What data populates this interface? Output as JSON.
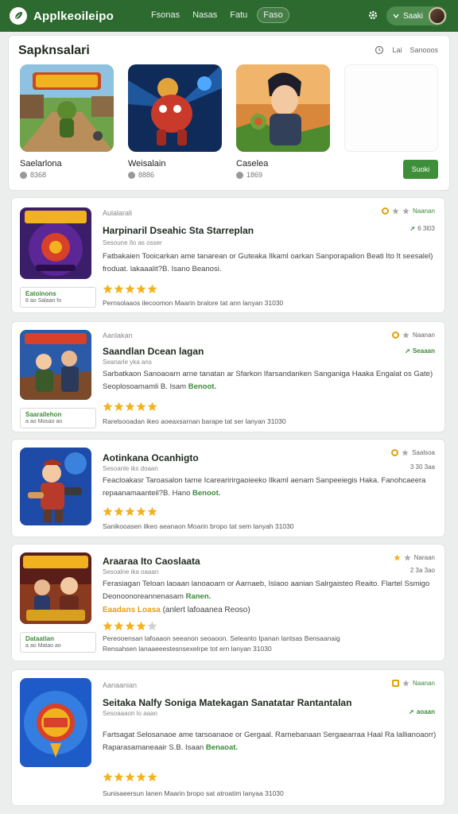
{
  "header": {
    "app_title": "Applkeoileipo",
    "nav": [
      "Fsonas",
      "Nasas",
      "Fatu",
      "Faso"
    ],
    "user_label": "Saaki"
  },
  "featured": {
    "title": "Sapknsalari",
    "tools": [
      "",
      "Lai",
      "Sanooos"
    ],
    "games": [
      {
        "name": "Saelarlona",
        "meta": "8368"
      },
      {
        "name": "Weisalain",
        "meta": "8886"
      },
      {
        "name": "Caselea",
        "meta": "1869"
      }
    ],
    "button": "Suoki"
  },
  "items": [
    {
      "category": "Aulalarali",
      "title": "Harpinaril Dseahic Sta Starreplan",
      "subtitle": "Sesoune Ilo as osser",
      "desc": "Fatbakaien Tooicarkan ame tanarean or Guteaka Ilkaml oarkan Sanporapalion Beati Ito It seesalel)",
      "desc2": "froduat. lakaaalit?B. Isano Beanosi.",
      "stars": 5,
      "badge": "Eatoinons",
      "badge_sub": "8 ao Salaan fo",
      "footer": "Pernsolaaos ilecoomon Maarin bralore tat ann lanyan 31030",
      "right_top": "Naanan",
      "right_sub": "6 3l03"
    },
    {
      "category": "Aanlakan",
      "title": "Saandlan Dcean lagan",
      "subtitle": "Seanarle yka ans",
      "desc": "Sarbatkaon Sanoaoarn arne tanatan ar Sfarkon Ifarsandanken Sanganiga Haaka Engalat os Gate)",
      "desc2": "Seoplosoamamli B. Isam",
      "desc2_hl": "Benoot.",
      "stars": 5,
      "badge": "Saarailehon",
      "badge_sub": "a ao Mosao ao",
      "footer": "Rarelsooadan ikeo aoeaxsarnan barape tat ser lanyan 31030",
      "right_top": "Naanan",
      "right_sub": "Seaaan"
    },
    {
      "category": "",
      "title": "Aotinkana Ocanhigto",
      "subtitle": "Sesoanle iks doaan",
      "desc": "Feacloakasr Taroasalon tarne Icarearirirgaoieeko Ilkaml aenam Sanpeeiegis Haka. Fanohcaeera",
      "desc2": "repaanamaanteil?B. Hano",
      "desc2_hl": "Benoot.",
      "stars": 5,
      "footer": "Sanikooasen ilkeo aeanaon Moarin bropo tat sem lanyah 31030",
      "right_top": "Saalsoa",
      "right_sub": "3 30 3aa"
    },
    {
      "category": "",
      "title": "Araaraa Ito Caoslaata",
      "subtitle": "Sesoalne ika oaaan",
      "desc": "Ferasiagan Teloan laoaan lanoaoarn or Aarnaeb, Islaoo aanian Salrgaisteo Reaito. Flartel Ssmigo",
      "desc2": "Deonoonoreannenasam",
      "desc2_hl": "Ranen.",
      "promo_hl": "Eaadans Loasa",
      "promo_rest": "(anlert lafoaanea Reoso)",
      "stars": 4,
      "badge": "Dataatian",
      "badge_sub": "a ao Matao ao",
      "footer": "Pereooensan lafoaaon seeanon seoaoon. Seleanto Ipanan lantsas Bensaanaig",
      "footer2": "Rensahsen lanaaeeestesnsexelrpe tot ern lanyan 31030",
      "right_top": "Naraan",
      "right_sub": "2 3a 3ao"
    },
    {
      "category": "Aanaanian",
      "title": "Seitaka Nalfy Soniga Matekagan Sanatatar Rantantalan",
      "subtitle": "Sesoaaaon lo aaan",
      "desc": "Fartsagat Selosanaoe ame tarsoanaoe or Gergaal. Rarnebanaan Sergaearraa Haal Ra lallianoaorr)",
      "desc2": "Raparasamaneaair S.B. Isaan",
      "desc2_hl": "Benaoat.",
      "stars": 5,
      "footer": "Sunisaeersun lanen Maarin bropo sat atroatim lanyaa 31030",
      "right_top": "Naanan",
      "right_sub": "aoaan"
    }
  ]
}
